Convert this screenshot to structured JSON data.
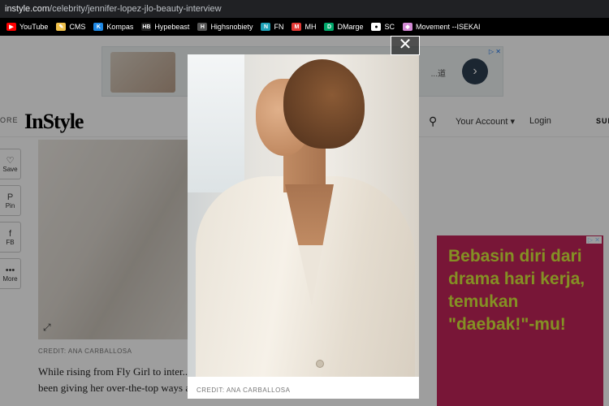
{
  "browser": {
    "url_domain": "instyle.com",
    "url_path": "/celebrity/jennifer-lopez-jlo-beauty-interview",
    "bookmarks": [
      {
        "label": "YouTube",
        "color": "#ff0000",
        "glyph": "▶"
      },
      {
        "label": "CMS",
        "color": "#f0c14b",
        "glyph": "✎"
      },
      {
        "label": "Kompas",
        "color": "#1e88e5",
        "glyph": "K"
      },
      {
        "label": "Hypebeast",
        "color": "#222222",
        "glyph": "HB"
      },
      {
        "label": "Highsnobiety",
        "color": "#555555",
        "glyph": "H"
      },
      {
        "label": "FN",
        "color": "#1fa2b8",
        "glyph": "N"
      },
      {
        "label": "MH",
        "color": "#e53935",
        "glyph": "M"
      },
      {
        "label": "DMarge",
        "color": "#00a86b",
        "glyph": "D"
      },
      {
        "label": "SC",
        "color": "#ffffff",
        "glyph": "●"
      },
      {
        "label": "Movement --ISEKAI",
        "color": "#d48ad6",
        "glyph": "◆"
      }
    ]
  },
  "ad_top": {
    "text": "...道",
    "choice": "▷ ✕"
  },
  "header": {
    "more": "ORE",
    "logo": "InStyle",
    "account": "Your Account ▾",
    "login": "Login",
    "subscribe": "SUB"
  },
  "social": [
    {
      "label": "Save",
      "icon": "♡"
    },
    {
      "label": "Pin",
      "icon": "P"
    },
    {
      "label": "FB",
      "icon": "f"
    },
    {
      "label": "More",
      "icon": "•••"
    }
  ],
  "article": {
    "credit": "CREDIT: ANA CARBALLOSA",
    "body": "While rising from Fly Girl to inter... been perfecting the art of glam for... icon says she's been giving her over-the-top ways a rest. When she's not sussed"
  },
  "ad_side": {
    "text": "Bebasin diri dari drama hari kerja, temukan \"daebak!\"-mu!",
    "choice": "▷ ✕"
  },
  "lightbox": {
    "credit": "CREDIT: ANA CARBALLOSA",
    "close": "✕"
  }
}
